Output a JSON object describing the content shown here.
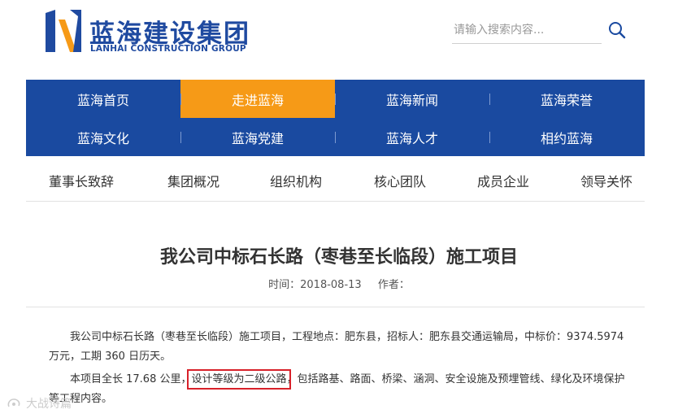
{
  "header": {
    "logo_cn": "蓝海建设集团",
    "logo_en": "LANHAI CONSTRUCTION GROUP",
    "search_placeholder": "请输入搜索内容..."
  },
  "nav": {
    "items": [
      {
        "label": "蓝海首页",
        "active": false
      },
      {
        "label": "走进蓝海",
        "active": true
      },
      {
        "label": "蓝海新闻",
        "active": false
      },
      {
        "label": "蓝海荣誉",
        "active": false
      },
      {
        "label": "蓝海文化",
        "active": false
      },
      {
        "label": "蓝海党建",
        "active": false
      },
      {
        "label": "蓝海人才",
        "active": false
      },
      {
        "label": "相约蓝海",
        "active": false
      }
    ]
  },
  "subnav": {
    "items": [
      "董事长致辞",
      "集团概况",
      "组织机构",
      "核心团队",
      "成员企业",
      "领导关怀"
    ]
  },
  "article": {
    "title": "我公司中标石长路（枣巷至长临段）施工项目",
    "time_label": "时间：2018-08-13",
    "author_label": "作者：",
    "para1": "我公司中标石长路（枣巷至长临段）施工项目，工程地点：肥东县，招标人：肥东县交通运输局，中标价：9374.5974万元，工期 360 日历天。",
    "para2_before": "本项目全长 17.68 公里，",
    "para2_highlight": "设计等级为二级公路",
    "para2_after": "，包括路基、路面、桥梁、涵洞、安全设施及预埋管线、绿化及环境保护等工程内容。"
  },
  "watermark": {
    "text": "大战诗篇"
  },
  "colors": {
    "brand_blue": "#1a4aa0",
    "active_orange": "#f69a17",
    "highlight_red": "#d8212a"
  }
}
